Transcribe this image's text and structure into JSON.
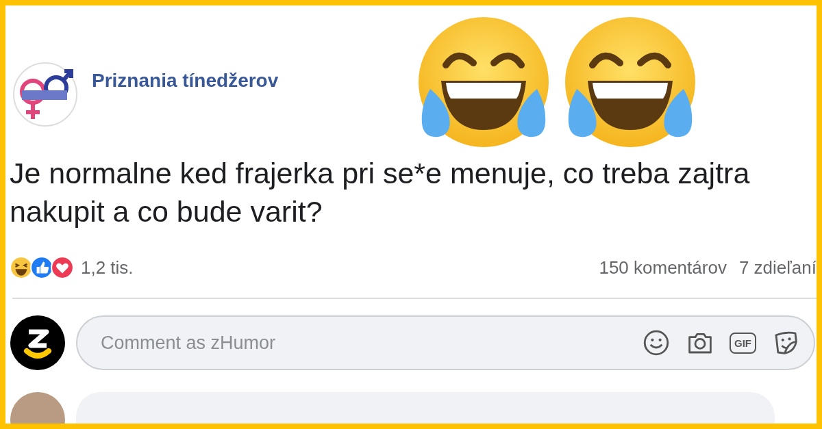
{
  "page": {
    "name": "Priznania tínedžerov"
  },
  "post": {
    "text": "Je normalne ked frajerka pri se*e menuje, co treba zajtra nakupit a co bude varit?"
  },
  "reactions": {
    "count": "1,2 tis.",
    "comments": "150 komentárov",
    "shares": "7 zdieľaní"
  },
  "comment_box": {
    "placeholder": "Comment as zHumor",
    "gif_label": "GIF"
  }
}
